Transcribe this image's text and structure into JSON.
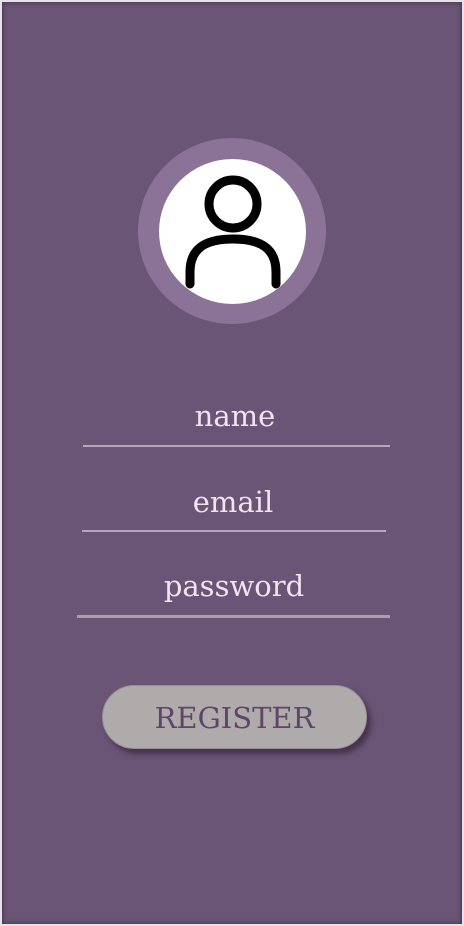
{
  "avatar": {
    "icon": "user-icon"
  },
  "form": {
    "name_placeholder": "name",
    "email_placeholder": "email",
    "password_placeholder": "password",
    "register_label": "REGISTER"
  },
  "colors": {
    "background": "#6a5576",
    "avatar_ring": "#8a7396",
    "field_text": "#f2e3ef",
    "button": "#b0abab",
    "button_text": "#5d4669"
  }
}
